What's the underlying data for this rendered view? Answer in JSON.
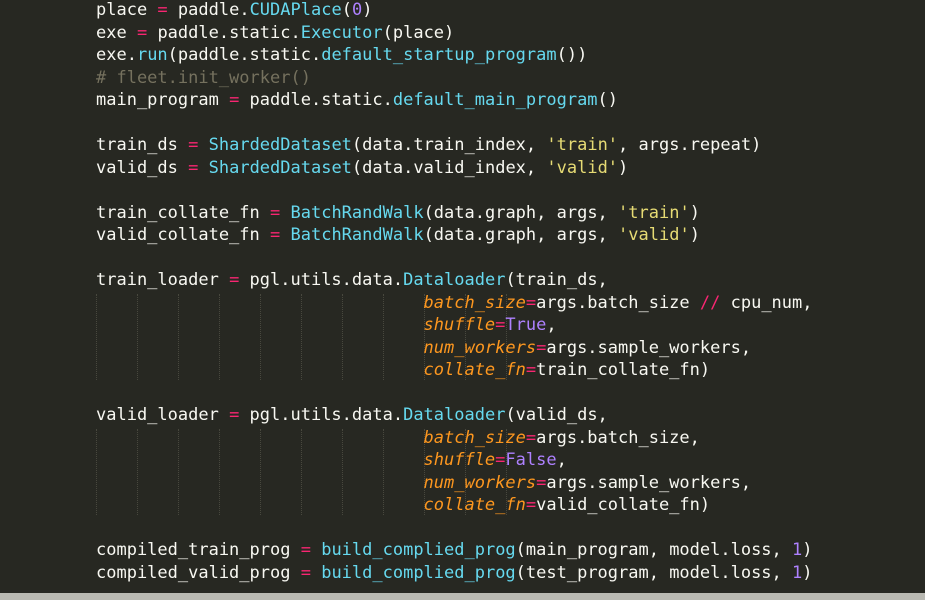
{
  "theme": {
    "background": "#272822",
    "foreground": "#F8F8F2",
    "operator": "#F92672",
    "function": "#66D9EF",
    "number_keyword": "#AE81FF",
    "string": "#E6DB74",
    "parameter": "#FD971F",
    "comment": "#75715E"
  },
  "code": {
    "lines": [
      [
        [
          "var",
          "place "
        ],
        [
          "op",
          "="
        ],
        [
          "var",
          " paddle."
        ],
        [
          "fn",
          "CUDAPlace"
        ],
        [
          "punc",
          "("
        ],
        [
          "num",
          "0"
        ],
        [
          "punc",
          ")"
        ]
      ],
      [
        [
          "var",
          "exe "
        ],
        [
          "op",
          "="
        ],
        [
          "var",
          " paddle.static."
        ],
        [
          "fn",
          "Executor"
        ],
        [
          "punc",
          "(place)"
        ]
      ],
      [
        [
          "var",
          "exe."
        ],
        [
          "fn",
          "run"
        ],
        [
          "punc",
          "(paddle.static."
        ],
        [
          "fn",
          "default_startup_program"
        ],
        [
          "punc",
          "())"
        ]
      ],
      [
        [
          "com",
          "# fleet.init_worker()"
        ]
      ],
      [
        [
          "var",
          "main_program "
        ],
        [
          "op",
          "="
        ],
        [
          "var",
          " paddle.static."
        ],
        [
          "fn",
          "default_main_program"
        ],
        [
          "punc",
          "()"
        ]
      ],
      [],
      [
        [
          "var",
          "train_ds "
        ],
        [
          "op",
          "="
        ],
        [
          "var",
          " "
        ],
        [
          "fn",
          "ShardedDataset"
        ],
        [
          "punc",
          "(data.train_index, "
        ],
        [
          "str",
          "'train'"
        ],
        [
          "punc",
          ", args.repeat)"
        ]
      ],
      [
        [
          "var",
          "valid_ds "
        ],
        [
          "op",
          "="
        ],
        [
          "var",
          " "
        ],
        [
          "fn",
          "ShardedDataset"
        ],
        [
          "punc",
          "(data.valid_index, "
        ],
        [
          "str",
          "'valid'"
        ],
        [
          "punc",
          ")"
        ]
      ],
      [],
      [
        [
          "var",
          "train_collate_fn "
        ],
        [
          "op",
          "="
        ],
        [
          "var",
          " "
        ],
        [
          "fn",
          "BatchRandWalk"
        ],
        [
          "punc",
          "(data.graph, args, "
        ],
        [
          "str",
          "'train'"
        ],
        [
          "punc",
          ")"
        ]
      ],
      [
        [
          "var",
          "valid_collate_fn "
        ],
        [
          "op",
          "="
        ],
        [
          "var",
          " "
        ],
        [
          "fn",
          "BatchRandWalk"
        ],
        [
          "punc",
          "(data.graph, args, "
        ],
        [
          "str",
          "'valid'"
        ],
        [
          "punc",
          ")"
        ]
      ],
      [],
      [
        [
          "var",
          "train_loader "
        ],
        [
          "op",
          "="
        ],
        [
          "var",
          " pgl.utils.data."
        ],
        [
          "fn",
          "Dataloader"
        ],
        [
          "punc",
          "(train_ds,"
        ]
      ],
      [
        [
          "var",
          "                                "
        ],
        [
          "param",
          "batch_size"
        ],
        [
          "op",
          "="
        ],
        [
          "var",
          "args.batch_size "
        ],
        [
          "op",
          "//"
        ],
        [
          "var",
          " cpu_num,"
        ]
      ],
      [
        [
          "var",
          "                                "
        ],
        [
          "param",
          "shuffle"
        ],
        [
          "op",
          "="
        ],
        [
          "kw",
          "True"
        ],
        [
          "punc",
          ","
        ]
      ],
      [
        [
          "var",
          "                                "
        ],
        [
          "param",
          "num_workers"
        ],
        [
          "op",
          "="
        ],
        [
          "var",
          "args.sample_workers,"
        ]
      ],
      [
        [
          "var",
          "                                "
        ],
        [
          "param",
          "collate_fn"
        ],
        [
          "op",
          "="
        ],
        [
          "var",
          "train_collate_fn)"
        ]
      ],
      [],
      [
        [
          "var",
          "valid_loader "
        ],
        [
          "op",
          "="
        ],
        [
          "var",
          " pgl.utils.data."
        ],
        [
          "fn",
          "Dataloader"
        ],
        [
          "punc",
          "(valid_ds,"
        ]
      ],
      [
        [
          "var",
          "                                "
        ],
        [
          "param",
          "batch_size"
        ],
        [
          "op",
          "="
        ],
        [
          "var",
          "args.batch_size,"
        ]
      ],
      [
        [
          "var",
          "                                "
        ],
        [
          "param",
          "shuffle"
        ],
        [
          "op",
          "="
        ],
        [
          "kw",
          "False"
        ],
        [
          "punc",
          ","
        ]
      ],
      [
        [
          "var",
          "                                "
        ],
        [
          "param",
          "num_workers"
        ],
        [
          "op",
          "="
        ],
        [
          "var",
          "args.sample_workers,"
        ]
      ],
      [
        [
          "var",
          "                                "
        ],
        [
          "param",
          "collate_fn"
        ],
        [
          "op",
          "="
        ],
        [
          "var",
          "valid_collate_fn)"
        ]
      ],
      [],
      [
        [
          "var",
          "compiled_train_prog "
        ],
        [
          "op",
          "="
        ],
        [
          "var",
          " "
        ],
        [
          "fn",
          "build_complied_prog"
        ],
        [
          "punc",
          "(main_program, model.loss, "
        ],
        [
          "num",
          "1"
        ],
        [
          "punc",
          ")"
        ]
      ],
      [
        [
          "var",
          "compiled_valid_prog "
        ],
        [
          "op",
          "="
        ],
        [
          "var",
          " "
        ],
        [
          "fn",
          "build_complied_prog"
        ],
        [
          "punc",
          "(test_program, model.loss, "
        ],
        [
          "num",
          "1"
        ],
        [
          "punc",
          ")"
        ]
      ]
    ]
  }
}
